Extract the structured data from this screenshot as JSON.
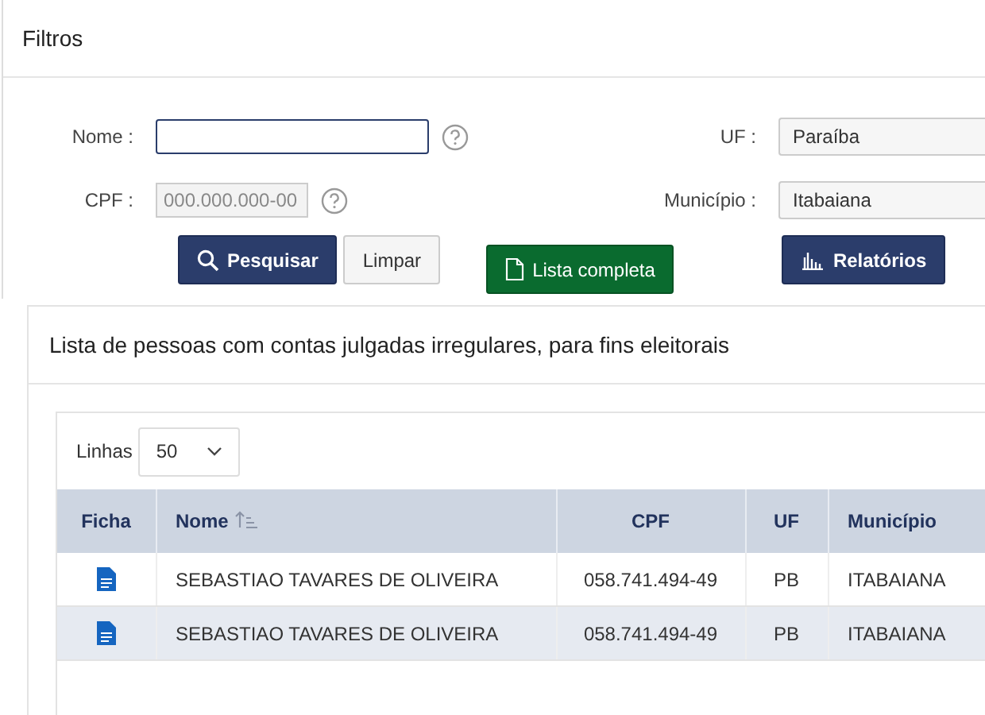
{
  "filters": {
    "title": "Filtros",
    "fields": [
      {
        "label": "Nome :",
        "kind": "text"
      },
      {
        "label": "CPF :",
        "kind": "masked",
        "placeholder": "000.000.000-00"
      }
    ],
    "selects": [
      {
        "label": "UF :",
        "value": "Paraíba"
      },
      {
        "label": "Município :",
        "value": "Itabaiana"
      }
    ],
    "buttons": {
      "search": "Pesquisar",
      "clear": "Limpar",
      "full_list": "Lista completa",
      "reports": "Relatórios"
    }
  },
  "results": {
    "title": "Lista de pessoas com contas julgadas irregulares, para fins eleitorais",
    "rows_label": "Linhas",
    "rows_value": "50",
    "columns": [
      {
        "label": "Ficha",
        "sorted": false
      },
      {
        "label": "Nome",
        "sorted": true
      },
      {
        "label": "CPF",
        "sorted": false
      },
      {
        "label": "UF",
        "sorted": false
      },
      {
        "label": "Município",
        "sorted": false
      }
    ],
    "rows": [
      {
        "name": "SEBASTIAO TAVARES DE OLIVEIRA",
        "cpf": "058.741.494-49",
        "uf": "PB",
        "municipio": "ITABAIANA"
      },
      {
        "name": "SEBASTIAO TAVARES DE OLIVEIRA",
        "cpf": "058.741.494-49",
        "uf": "PB",
        "municipio": "ITABAIANA"
      }
    ]
  }
}
